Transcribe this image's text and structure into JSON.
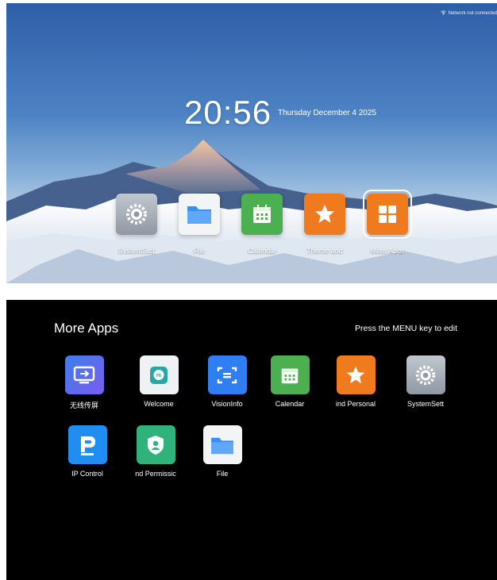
{
  "home": {
    "status": "Network not connected",
    "time": "20:56",
    "date": "Thursday December 4 2025",
    "dock": [
      {
        "label": "SystemSett",
        "icon": "gear-icon",
        "color": "#9aa3ad",
        "selected": false
      },
      {
        "label": "File",
        "icon": "folder-icon",
        "color": "#f2f4f6",
        "selected": false
      },
      {
        "label": "Calendar",
        "icon": "calendar-icon",
        "color": "#4caf50",
        "selected": false
      },
      {
        "label": "Theme and",
        "icon": "star-icon",
        "color": "#f07a1e",
        "selected": false
      },
      {
        "label": "More Apps",
        "icon": "grid-icon",
        "color": "#f07a1e",
        "selected": true
      }
    ]
  },
  "more_apps": {
    "title": "More Apps",
    "hint": "Press the MENU key to edit",
    "apps": [
      {
        "label": "无线传屏",
        "icon": "screen-cast-icon",
        "color": "#3f7de8"
      },
      {
        "label": "Welcome",
        "icon": "chat-bubble-icon",
        "color": "#2aa6a6"
      },
      {
        "label": "VisionInfo",
        "icon": "scan-frame-icon",
        "color": "#2f7ef2"
      },
      {
        "label": "Calendar",
        "icon": "calendar-icon",
        "color": "#4caf50"
      },
      {
        "label": "ind Personal",
        "icon": "star-icon",
        "color": "#f07a1e"
      },
      {
        "label": "SystemSett",
        "icon": "gear-icon",
        "color": "#9aa3ad"
      },
      {
        "label": "IP Control",
        "icon": "ip-control-icon",
        "color": "#1f8ef0"
      },
      {
        "label": "nd Permissic",
        "icon": "shield-user-icon",
        "color": "#2fb37a"
      },
      {
        "label": "File",
        "icon": "folder-icon",
        "color": "#f2f4f6"
      }
    ]
  }
}
